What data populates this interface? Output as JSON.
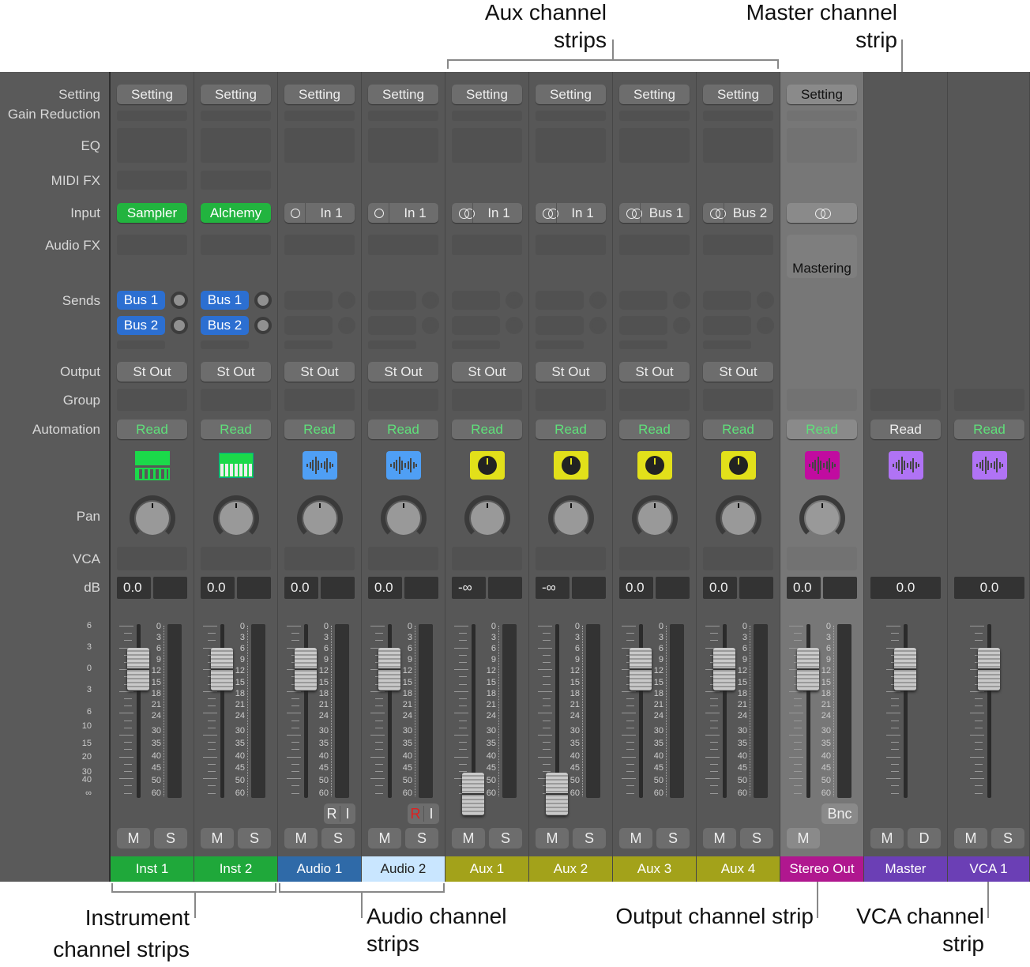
{
  "annotations": {
    "aux_top": [
      "Aux channel",
      "strips"
    ],
    "master_top": [
      "Master channel",
      "strip"
    ],
    "instrument": [
      "Instrument",
      "channel strips"
    ],
    "audio": [
      "Audio channel",
      "strips"
    ],
    "output": "Output channel strip",
    "vca": [
      "VCA channel",
      "strip"
    ]
  },
  "row_labels": {
    "setting": "Setting",
    "gain_reduction": "Gain Reduction",
    "eq": "EQ",
    "midi_fx": "MIDI FX",
    "input": "Input",
    "audio_fx": "Audio FX",
    "sends": "Sends",
    "output": "Output",
    "group": "Group",
    "automation": "Automation",
    "pan": "Pan",
    "vca": "VCA",
    "db": "dB"
  },
  "fader_scale": [
    "6",
    "3",
    "0",
    "3",
    "6",
    "10",
    "15",
    "20",
    "30",
    "40",
    "∞"
  ],
  "meter_scale": [
    "0",
    "3",
    "6",
    "9",
    "12",
    "15",
    "18",
    "21",
    "24",
    "30",
    "35",
    "40",
    "45",
    "50",
    "60"
  ],
  "colors": {
    "read_green": "#5fe07a",
    "inst": "#1fa83a",
    "audio1": "#2f6aa8",
    "audio2": "#c9e6ff",
    "aux": "#a3a21a",
    "stereo_out": "#b0178f",
    "master": "#6b3fb5",
    "vca": "#6b3fb5",
    "send_blue": "#2c6fd1"
  },
  "strips": [
    {
      "type": "inst",
      "name": "Inst 1",
      "setting": "Setting",
      "input": "Sampler",
      "sends": [
        "Bus 1",
        "Bus 2"
      ],
      "output": "St Out",
      "automation": "Read",
      "icon": "sampler-icon",
      "db": "0.0",
      "fader_db": 0,
      "m": "M",
      "s": "S"
    },
    {
      "type": "inst",
      "name": "Inst 2",
      "setting": "Setting",
      "input": "Alchemy",
      "sends": [
        "Bus 1",
        "Bus 2"
      ],
      "output": "St Out",
      "automation": "Read",
      "icon": "synth-icon",
      "db": "0.0",
      "fader_db": 0,
      "m": "M",
      "s": "S"
    },
    {
      "type": "audio",
      "name": "Audio 1",
      "setting": "Setting",
      "input": "In 1",
      "input_icon": "mono",
      "output": "St Out",
      "automation": "Read",
      "icon": "waveform-icon",
      "db": "0.0",
      "fader_db": 0,
      "r": "R",
      "i": "I",
      "r_active": false,
      "m": "M",
      "s": "S"
    },
    {
      "type": "audio",
      "name": "Audio 2",
      "setting": "Setting",
      "input": "In 1",
      "input_icon": "mono",
      "output": "St Out",
      "automation": "Read",
      "icon": "waveform-icon",
      "db": "0.0",
      "fader_db": 0,
      "r": "R",
      "i": "I",
      "r_active": true,
      "m": "M",
      "s": "S"
    },
    {
      "type": "aux",
      "name": "Aux 1",
      "setting": "Setting",
      "input": "In 1",
      "input_icon": "stereo",
      "output": "St Out",
      "automation": "Read",
      "icon": "aux-knob-icon",
      "db": "-∞",
      "fader_db": "-inf",
      "m": "M",
      "s": "S"
    },
    {
      "type": "aux",
      "name": "Aux 2",
      "setting": "Setting",
      "input": "In 1",
      "input_icon": "stereo",
      "output": "St Out",
      "automation": "Read",
      "icon": "aux-knob-icon",
      "db": "-∞",
      "fader_db": "-inf",
      "m": "M",
      "s": "S"
    },
    {
      "type": "aux",
      "name": "Aux 3",
      "setting": "Setting",
      "input": "Bus 1",
      "input_icon": "stereo",
      "output": "St Out",
      "automation": "Read",
      "icon": "aux-knob-icon",
      "db": "0.0",
      "fader_db": 0,
      "m": "M",
      "s": "S"
    },
    {
      "type": "aux",
      "name": "Aux 4",
      "setting": "Setting",
      "input": "Bus 2",
      "input_icon": "stereo",
      "output": "St Out",
      "automation": "Read",
      "icon": "aux-knob-icon",
      "db": "0.0",
      "fader_db": 0,
      "m": "M",
      "s": "S"
    },
    {
      "type": "out",
      "name": "Stereo Out",
      "setting": "Setting",
      "input": "",
      "input_icon": "stereo",
      "audio_fx": "Mastering",
      "automation": "Read",
      "icon": "waveform-icon",
      "db": "0.0",
      "fader_db": 0,
      "bnc": "Bnc",
      "m": "M"
    },
    {
      "type": "master",
      "name": "Master",
      "automation": "Read",
      "icon": "waveform-icon",
      "db": "0.0",
      "fader_db": 0,
      "m": "M",
      "d": "D"
    },
    {
      "type": "vca",
      "name": "VCA 1",
      "automation": "Read",
      "icon": "waveform-icon",
      "db": "0.0",
      "fader_db": 0,
      "m": "M",
      "s": "S"
    }
  ]
}
